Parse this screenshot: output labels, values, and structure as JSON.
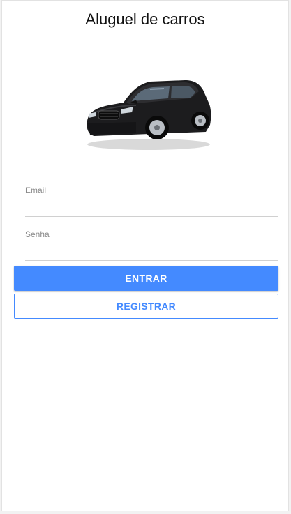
{
  "app": {
    "title": "Aluguel de carros"
  },
  "hero": {
    "icon": "car-image"
  },
  "form": {
    "email": {
      "label": "Email",
      "value": ""
    },
    "password": {
      "label": "Senha",
      "value": ""
    }
  },
  "actions": {
    "login_label": "ENTRAR",
    "register_label": "REGISTRAR"
  },
  "colors": {
    "accent": "#448aff"
  }
}
